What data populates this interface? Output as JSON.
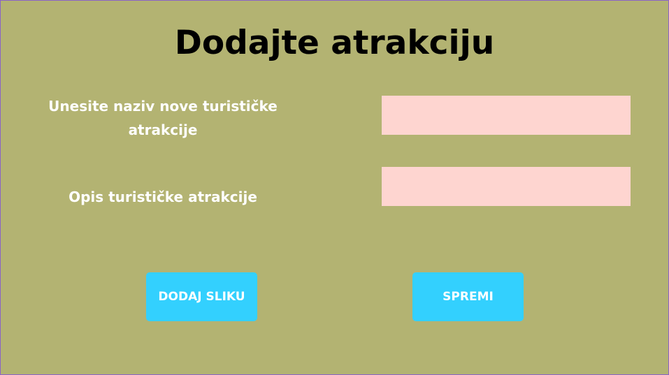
{
  "form": {
    "title": "Dodajte atrakciju",
    "name_label": "Unesite naziv nove turističke atrakcije",
    "name_value": "",
    "description_label": "Opis turističke atrakcije",
    "description_value": "",
    "add_image_label": "DODAJ SLIKU",
    "save_label": "SPREMI"
  },
  "colors": {
    "background": "#b3b372",
    "input": "#fed5d0",
    "button": "#33d0fe",
    "label": "#ffffff",
    "title": "#000000"
  }
}
